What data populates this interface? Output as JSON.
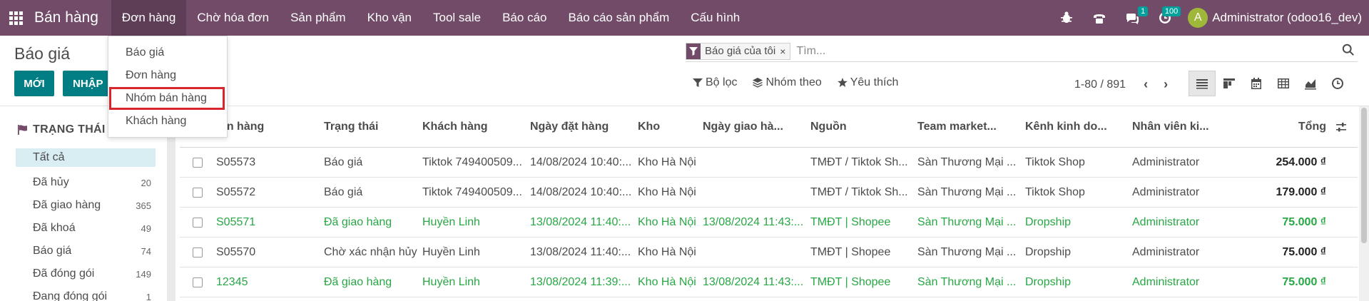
{
  "navbar": {
    "brand": "Bán hàng",
    "menu": [
      {
        "label": "Đơn hàng",
        "active": true
      },
      {
        "label": "Chờ hóa đơn"
      },
      {
        "label": "Sản phẩm"
      },
      {
        "label": "Kho vận"
      },
      {
        "label": "Tool sale"
      },
      {
        "label": "Báo cáo"
      },
      {
        "label": "Báo cáo sản phẩm"
      },
      {
        "label": "Cấu hình"
      }
    ],
    "icons": {
      "debug": "bug-icon",
      "phone": "phone-icon",
      "chat": "chat-icon",
      "activity": "clock-icon"
    },
    "chat_badge": "1",
    "activity_badge": "100",
    "user_initial": "A",
    "user_name": "Administrator (odoo16_dev)",
    "colors": {
      "bar": "#714b67",
      "badge": "#00a09d",
      "avatar": "#9fb83a"
    }
  },
  "dropdown": {
    "items": [
      {
        "label": "Báo giá"
      },
      {
        "label": "Đơn hàng"
      },
      {
        "label": "Nhóm bán hàng",
        "highlighted": true
      },
      {
        "label": "Khách hàng"
      }
    ]
  },
  "control": {
    "title": "Báo giá",
    "new_label": "MỚI",
    "import_label": "NHẬP",
    "facet_label": "Báo giá của tôi",
    "facet_close": "×",
    "search_placeholder": "Tìm...",
    "filter_label": "Bộ lọc",
    "group_label": "Nhóm theo",
    "favorite_label": "Yêu thích",
    "pager": "1-80 / 891",
    "prev": "‹",
    "next": "›",
    "accent": "#017e84"
  },
  "sidebar": {
    "heading": "TRẠNG THÁI",
    "items": [
      {
        "label": "Tất cả",
        "count": "",
        "active": true
      },
      {
        "label": "Đã hủy",
        "count": "20"
      },
      {
        "label": "Đã giao hàng",
        "count": "365"
      },
      {
        "label": "Đã khoá",
        "count": "49"
      },
      {
        "label": "Báo giá",
        "count": "74"
      },
      {
        "label": "Đã đóng gói",
        "count": "149"
      },
      {
        "label": "Đang đóng gói",
        "count": "1"
      }
    ]
  },
  "table": {
    "headers": {
      "order": "Mã đơn hàng",
      "status": "Trạng thái",
      "customer": "Khách hàng",
      "order_date": "Ngày đặt hàng",
      "warehouse": "Kho",
      "delivery_date": "Ngày giao hà...",
      "source": "Nguồn",
      "team": "Team market...",
      "channel": "Kênh kinh do...",
      "salesperson": "Nhân viên ki...",
      "total": "Tổng"
    },
    "rows": [
      {
        "order": "S05573",
        "status": "Báo giá",
        "customer": "Tiktok 749400509...",
        "order_date": "14/08/2024 10:40:...",
        "warehouse": "Kho Hà Nội",
        "delivery_date": "",
        "source": "TMĐT / Tiktok Sh...",
        "team": "Sàn Thương Mại ...",
        "channel": "Tiktok Shop",
        "salesperson": "Administrator",
        "total": "254.000 ₫",
        "green": false
      },
      {
        "order": "S05572",
        "status": "Báo giá",
        "customer": "Tiktok 749400509...",
        "order_date": "14/08/2024 10:40:...",
        "warehouse": "Kho Hà Nội",
        "delivery_date": "",
        "source": "TMĐT / Tiktok Sh...",
        "team": "Sàn Thương Mại ...",
        "channel": "Tiktok Shop",
        "salesperson": "Administrator",
        "total": "179.000 ₫",
        "green": false
      },
      {
        "order": "S05571",
        "status": "Đã giao hàng",
        "customer": "Huyền Linh",
        "order_date": "13/08/2024 11:40:...",
        "warehouse": "Kho Hà Nội",
        "delivery_date": "13/08/2024 11:43:...",
        "source": "TMĐT | Shopee",
        "team": "Sàn Thương Mại ...",
        "channel": "Dropship",
        "salesperson": "Administrator",
        "total": "75.000 ₫",
        "green": true
      },
      {
        "order": "S05570",
        "status": "Chờ xác nhận hủy",
        "customer": "Huyền Linh",
        "order_date": "13/08/2024 11:40:...",
        "warehouse": "Kho Hà Nội",
        "delivery_date": "",
        "source": "TMĐT | Shopee",
        "team": "Sàn Thương Mại ...",
        "channel": "Dropship",
        "salesperson": "Administrator",
        "total": "75.000 ₫",
        "green": false
      },
      {
        "order": "12345",
        "status": "Đã giao hàng",
        "customer": "Huyền Linh",
        "order_date": "13/08/2024 11:39:...",
        "warehouse": "Kho Hà Nội",
        "delivery_date": "13/08/2024 11:43:...",
        "source": "TMĐT | Shopee",
        "team": "Sàn Thương Mại ...",
        "channel": "Dropship",
        "salesperson": "Administrator",
        "total": "75.000 ₫",
        "green": true
      }
    ]
  }
}
